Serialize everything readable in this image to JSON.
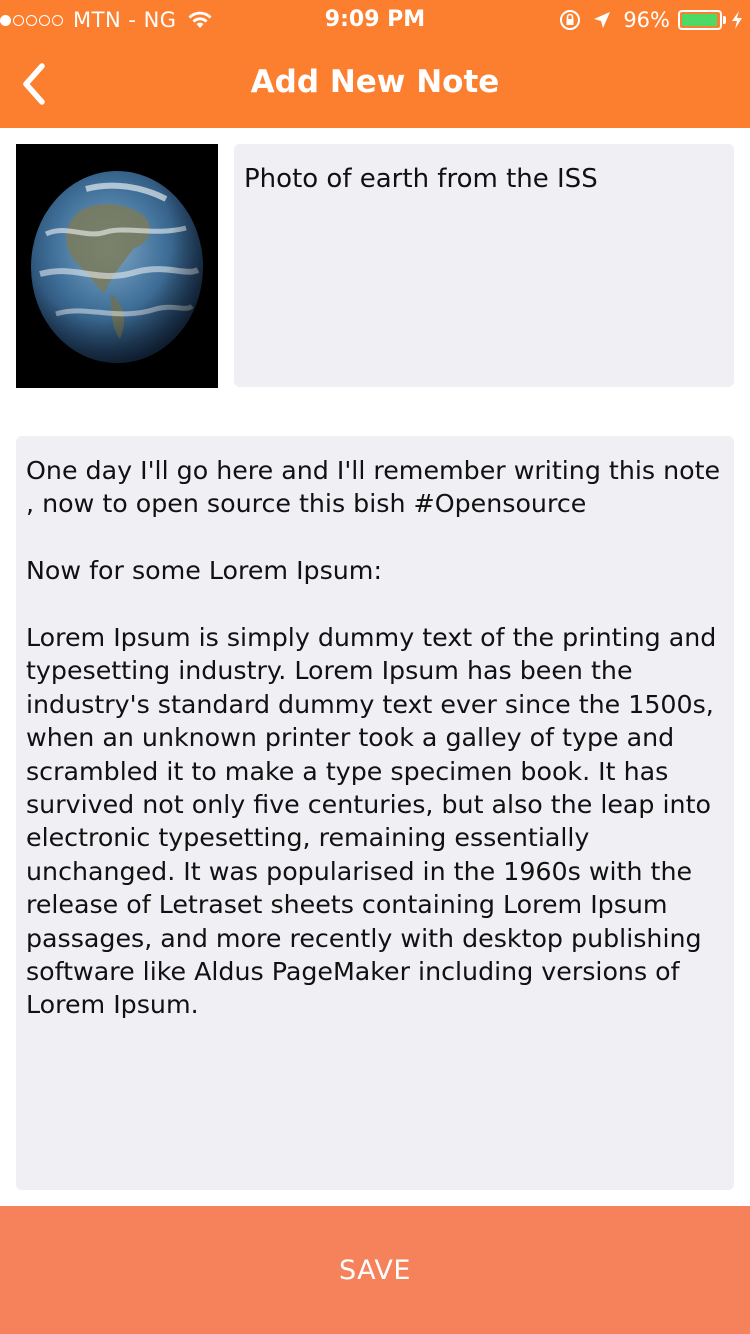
{
  "status_bar": {
    "carrier": "MTN - NG",
    "time": "9:09 PM",
    "battery_percent": "96%",
    "battery_level": 0.96,
    "signal_bars_filled": 1,
    "signal_bars_total": 5
  },
  "nav": {
    "title": "Add New Note",
    "back_icon": "chevron-left-icon"
  },
  "note": {
    "image_description_icon": "earth-photo",
    "caption": "Photo of earth from the ISS",
    "body_paragraphs": [
      "One day I'll go here and I'll remember writing this note ,  now to open source this bish #Opensource",
      "Now for some Lorem Ipsum:",
      "Lorem Ipsum is simply dummy text of the printing and typesetting industry. Lorem Ipsum has been the industry's standard dummy text ever since the 1500s, when an unknown printer took a galley of type and scrambled it to make a type specimen book. It has survived not only five centuries, but also the leap into electronic typesetting, remaining essentially unchanged. It was popularised in the 1960s with the release of Letraset sheets containing Lorem Ipsum passages, and more recently with desktop publishing software like Aldus PageMaker including versions of Lorem Ipsum."
    ]
  },
  "actions": {
    "save_label": "SAVE"
  },
  "colors": {
    "header": "#fc7f30",
    "save_button": "#f5825a",
    "field_background": "#efeff4"
  }
}
